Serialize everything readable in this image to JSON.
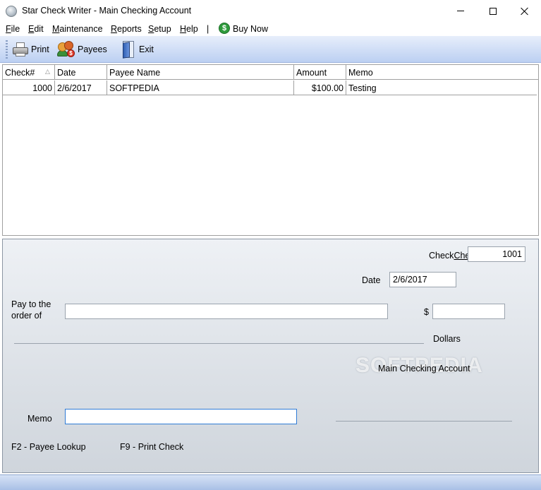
{
  "window": {
    "title": "Star Check Writer - Main Checking Account"
  },
  "menu": {
    "file": {
      "u": "F",
      "rest": "ile"
    },
    "edit": {
      "u": "E",
      "rest": "dit"
    },
    "maintenance": {
      "u": "M",
      "rest": "aintenance"
    },
    "reports": {
      "u": "R",
      "rest": "eports"
    },
    "setup": {
      "u": "S",
      "rest": "etup"
    },
    "help": {
      "u": "H",
      "rest": "elp"
    },
    "separator": "|",
    "buy_icon": "$",
    "buy_now": "Buy Now"
  },
  "toolbar": {
    "print": "Print",
    "payees": "Payees",
    "exit": "Exit"
  },
  "grid": {
    "columns": [
      "Check#",
      "Date",
      "Payee Name",
      "Amount",
      "Memo"
    ],
    "sort_indicator": "△",
    "rows": [
      {
        "check": "1000",
        "date": "2/6/2017",
        "payee": "SOFTPEDIA",
        "amount": "$100.00",
        "memo": "Testing"
      }
    ]
  },
  "check_form": {
    "check_label": "Check#",
    "check_value": "1001",
    "date_label": "Date",
    "date_value": "2/6/2017",
    "pay_to_line1": "Pay to the",
    "pay_to_line2": "order of",
    "payee_value": "",
    "dollar_sign": "$",
    "amount_value": "",
    "dollars_label": "Dollars",
    "account_name": "Main Checking Account",
    "memo_label": "Memo",
    "memo_value": "",
    "hint_payee_lookup": "F2 - Payee Lookup",
    "hint_print_check": "F9 - Print Check",
    "watermark": "SOFTPEDIA"
  }
}
